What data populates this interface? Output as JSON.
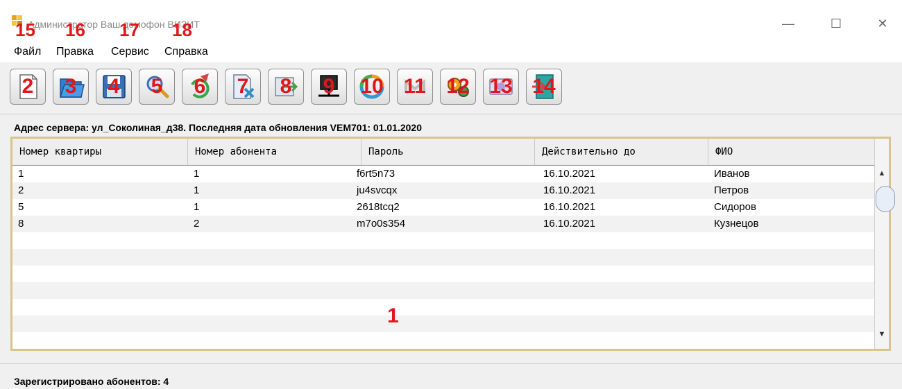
{
  "window": {
    "title": "Администратор Ваш домофон ВИЗИТ"
  },
  "menu": [
    {
      "label": "Файл",
      "number": "15"
    },
    {
      "label": "Правка",
      "number": "16"
    },
    {
      "label": "Сервис",
      "number": "17"
    },
    {
      "label": "Справка",
      "number": "18"
    }
  ],
  "toolbar": [
    {
      "icon": "new-document-icon",
      "number": "2"
    },
    {
      "icon": "open-folder-icon",
      "number": "3"
    },
    {
      "icon": "save-floppy-icon",
      "number": "4"
    },
    {
      "icon": "search-magnifier-icon",
      "number": "5"
    },
    {
      "icon": "refresh-edit-icon",
      "number": "6"
    },
    {
      "icon": "delete-icon",
      "number": "7"
    },
    {
      "icon": "import-icon",
      "number": "8"
    },
    {
      "icon": "network-computer-icon",
      "number": "9"
    },
    {
      "icon": "sync-circle-icon",
      "number": "10"
    },
    {
      "icon": "disabled-action-icon",
      "number": "11"
    },
    {
      "icon": "settings-gears-icon",
      "number": "12"
    },
    {
      "icon": "configuration-icon",
      "number": "13"
    },
    {
      "icon": "exit-door-icon",
      "number": "14"
    }
  ],
  "server_info": "Адрес сервера: ул_Соколиная_д38. Последняя дата обновления VEM701: 01.01.2020",
  "table": {
    "columns": [
      "Номер квартиры",
      "Номер абонента",
      "Пароль",
      "Действительно до",
      "ФИО"
    ],
    "rows": [
      [
        "1",
        "1",
        "f6rt5n73",
        "16.10.2021",
        "Иванов"
      ],
      [
        "2",
        "1",
        "ju4svcqx",
        "16.10.2021",
        "Петров"
      ],
      [
        "5",
        "1",
        "2618tcq2",
        "16.10.2021",
        "Сидоров"
      ],
      [
        "8",
        "2",
        "m7o0s354",
        "16.10.2021",
        "Кузнецов"
      ]
    ],
    "number": "1"
  },
  "status": "Зарегистрировано абонентов: 4",
  "colors": {
    "annotation": "#e0161b",
    "frame": "#d8c48c",
    "stripe": "#f2f2f2"
  }
}
